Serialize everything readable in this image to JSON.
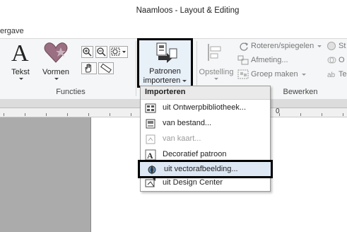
{
  "window": {
    "title": "Naamloos - Layout & Editing"
  },
  "tabs": {
    "active_label": "ergave"
  },
  "ribbon": {
    "functies": {
      "label": "Functies",
      "tekst_label": "Tekst",
      "vormen_label": "Vormen"
    },
    "patronen": {
      "line1": "Patronen",
      "line2": "importeren"
    },
    "opstelling_label": "Opstelling",
    "bewerken": {
      "label": "Bewerken",
      "roteren_label": "Roteren/spiegelen",
      "afmeting_label": "Afmeting...",
      "groep_label": "Groep maken",
      "truncated_st": "St",
      "truncated_o": "O",
      "truncated_te": "Te"
    }
  },
  "ruler": {
    "label_0": "0"
  },
  "menu": {
    "header": "Importeren",
    "items": [
      {
        "label": "uit Ontwerpbibliotheek...",
        "enabled": true
      },
      {
        "label": "van bestand...",
        "enabled": true
      },
      {
        "label": "van kaart...",
        "enabled": false
      },
      {
        "label": "Decoratief patroon",
        "enabled": true
      },
      {
        "label": "uit vectorafbeelding...",
        "enabled": true,
        "highlighted": true
      },
      {
        "label": "uit Design Center",
        "enabled": true
      }
    ]
  }
}
